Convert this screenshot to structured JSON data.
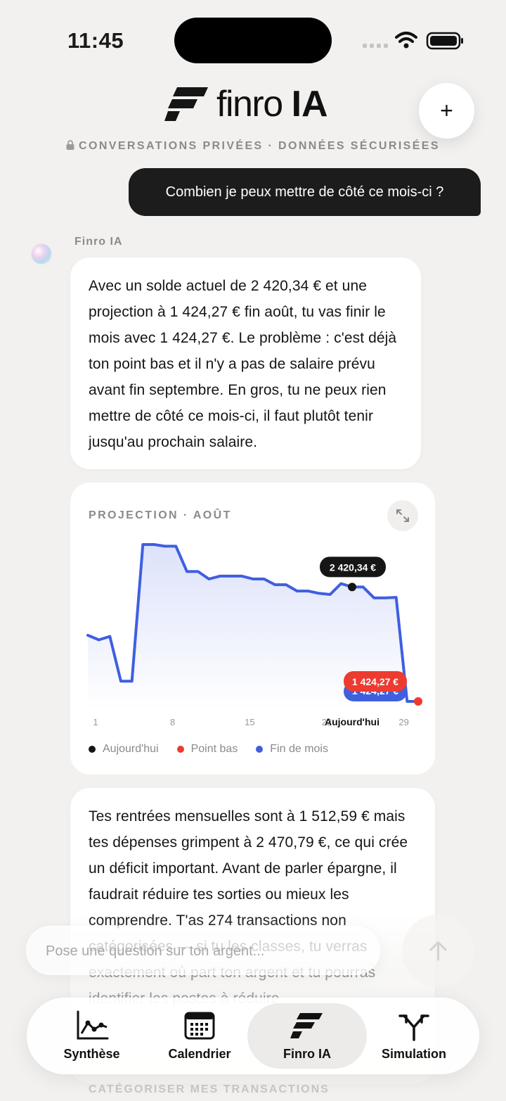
{
  "status_bar": {
    "time": "11:45"
  },
  "header": {
    "brand": "finro",
    "brand_suffix": "IA",
    "privacy_notice": "CONVERSATIONS PRIVÉES · DONNÉES SÉCURISÉES"
  },
  "conversation": {
    "user_message": "Combien je peux mettre de côté ce mois-ci ?",
    "bot_name": "Finro IA",
    "bot_message_1": "Avec un solde actuel de 2 420,34 € et une projection à 1 424,27 € fin août, tu vas finir le mois avec 1 424,27 €. Le problème : c'est déjà ton point bas et il n'y a pas de salaire prévu avant fin septembre. En gros, tu ne peux rien mettre de côté ce mois-ci, il faut plutôt tenir jusqu'au prochain salaire.",
    "bot_message_2": "Tes rentrées mensuelles sont à 1 512,59 € mais tes dépenses grimpent à 2 470,79 €, ce qui crée un déficit important. Avant de parler épargne, il faudrait réduire tes sorties ou mieux les comprendre. T'as 274 transactions non catégorisées — si tu les classes, tu verras exactement où part ton argent et tu pourras identifier les postes à réduire.",
    "ghost_action": "CATÉGORISER MES TRANSACTIONS"
  },
  "chart_card": {
    "title": "PROJECTION · AOÛT",
    "today_label": "Aujourd'hui",
    "today_badge": "2 420,34 €",
    "low_badge": "1 424,27 €",
    "end_badge": "1 424,27 €",
    "legend": [
      {
        "label": "Aujourd'hui",
        "color": "#161616"
      },
      {
        "label": "Point bas",
        "color": "#ee3b30"
      },
      {
        "label": "Fin de mois",
        "color": "#3f5fe0"
      }
    ]
  },
  "chart_data": {
    "type": "area",
    "x_ticks": [
      "1",
      "8",
      "15",
      "22",
      "29"
    ],
    "x": [
      1,
      2,
      3,
      4,
      5,
      6,
      7,
      8,
      9,
      10,
      11,
      12,
      13,
      14,
      15,
      16,
      17,
      18,
      19,
      20,
      21,
      22,
      23,
      24,
      25,
      26,
      27,
      28,
      29,
      30,
      31
    ],
    "values": [
      2000,
      1960,
      1990,
      1600,
      1600,
      2790,
      2790,
      2775,
      2775,
      2555,
      2555,
      2490,
      2515,
      2515,
      2515,
      2490,
      2490,
      2440,
      2440,
      2385,
      2385,
      2365,
      2355,
      2450,
      2420,
      2420,
      2325,
      2325,
      2330,
      1424,
      1424
    ],
    "today_x": 25,
    "today_value": 2420.34,
    "end_value": 1424.27,
    "low_value": 1424.27,
    "colors": {
      "line": "#3f5fe0",
      "today": "#161616",
      "low": "#ee3b30",
      "end": "#3f5fe0"
    }
  },
  "input": {
    "placeholder": "Pose une question sur ton argent..."
  },
  "tabbar": {
    "tabs": [
      {
        "label": "Synthèse",
        "icon": "chart-line-icon"
      },
      {
        "label": "Calendrier",
        "icon": "calendar-icon"
      },
      {
        "label": "Finro IA",
        "icon": "finro-logo-icon",
        "active": true
      },
      {
        "label": "Simulation",
        "icon": "split-arrows-icon"
      }
    ]
  }
}
